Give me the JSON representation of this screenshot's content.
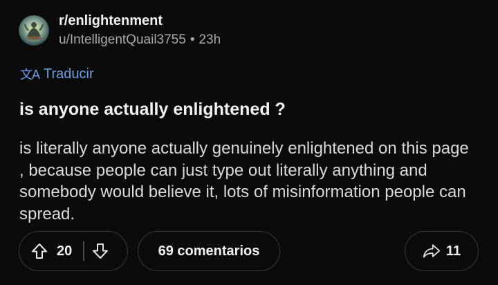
{
  "post": {
    "subreddit": "r/enlightenment",
    "author": "u/IntelligentQuail3755",
    "separator": "•",
    "age": "23h",
    "translate_label": "Traducir",
    "title": "is anyone actually enlightened ?",
    "body": "is literally anyone actually genuinely enlightened on this page , because people can just type out literally anything and somebody would believe it, lots of misinformation people can spread."
  },
  "actions": {
    "score": "20",
    "comments_label": "69 comentarios",
    "share_count": "11"
  },
  "icons": {
    "translate": "translate-icon",
    "upvote": "arrow-up-icon",
    "downvote": "arrow-down-icon",
    "share": "share-arrow-icon"
  },
  "colors": {
    "background": "#0b0b0b",
    "link": "#6e9fe8",
    "muted_text": "#a8aaab",
    "border": "#3a3a3a"
  }
}
